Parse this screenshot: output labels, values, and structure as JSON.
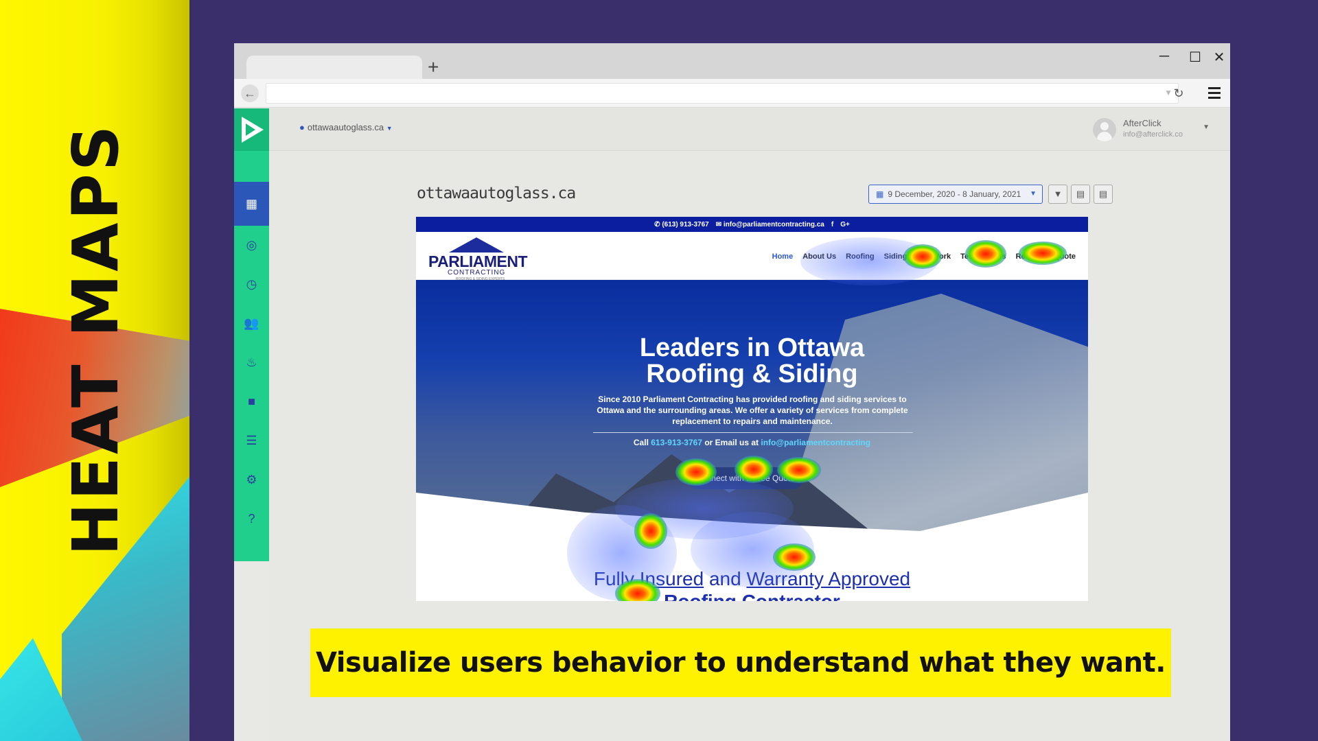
{
  "banner": {
    "title": "HEAT MAPS"
  },
  "caption": {
    "text": "Visualize users behavior to understand what they want."
  },
  "browser": {
    "new_tab": "+",
    "controls": {
      "minimize": "─",
      "maximize": "☐",
      "close": "✕"
    }
  },
  "app": {
    "site_selector": "ottawaautoglass.ca",
    "user": {
      "name": "AfterClick",
      "email": "info@afterclick.co"
    },
    "sidebar_icons": [
      "dashboard-icon",
      "target-icon",
      "clock-icon",
      "users-icon",
      "fire-icon",
      "video-icon",
      "list-icon",
      "user-settings-icon",
      "help-icon"
    ],
    "page_domain": "ottawaautoglass.ca",
    "date_range": "9 December, 2020 - 8 January, 2021"
  },
  "site": {
    "phone": "(613) 913-3767",
    "email": "info@parliamentcontracting.ca",
    "social": [
      "f",
      "G+"
    ],
    "brand_name": "PARLIAMENT",
    "brand_sub": "CONTRACTING",
    "brand_tag": "ROOFING & SIDING EXPERTS",
    "nav": [
      "Home",
      "About Us",
      "Roofing",
      "Siding",
      "Our Work",
      "Testimonials",
      "Request a Quote"
    ],
    "hero_title_1": "Leaders in Ottawa",
    "hero_title_2": "Roofing & Siding",
    "hero_desc": "Since 2010 Parliament Contracting has provided roofing and siding services to Ottawa and the surrounding areas. We offer a variety of services from complete replacement to repairs and maintenance.",
    "call_prefix": "Call",
    "call_phone": "613-913-3767",
    "call_mid": "or Email us at",
    "call_email": "info@parliamentcontracting",
    "cta": "Connect with a Free Quote",
    "sub_1": "Fully",
    "sub_2": "Insured",
    "sub_3": "and",
    "sub_4": "Warranty Approved",
    "sub_5": "Roofing Contractor"
  }
}
